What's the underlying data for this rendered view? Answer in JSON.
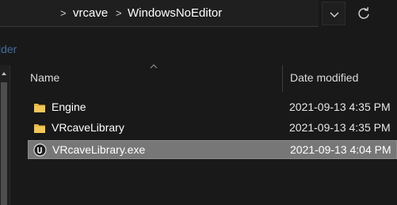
{
  "address_bar": {
    "breadcrumbs": [
      "vrcave",
      "WindowsNoEditor"
    ],
    "separator": ">",
    "dropdown_icon": "chevron-down-icon",
    "refresh_icon": "refresh-icon"
  },
  "command_bar": {
    "partial_text": "lder"
  },
  "columns": {
    "name": "Name",
    "date_modified": "Date modified"
  },
  "files": [
    {
      "name": "Engine",
      "date": "2021-09-13 4:35 PM",
      "type_icon": "folder-icon",
      "selected": false
    },
    {
      "name": "VRcaveLibrary",
      "date": "2021-09-13 4:35 PM",
      "type_icon": "folder-icon",
      "selected": false
    },
    {
      "name": "VRcaveLibrary.exe",
      "date": "2021-09-13 4:04 PM",
      "type_icon": "unreal-app-icon",
      "selected": true
    }
  ],
  "colors": {
    "background": "#191919",
    "selection": "#777777",
    "folder": "#e8b53d",
    "link": "#3f6d9c"
  }
}
